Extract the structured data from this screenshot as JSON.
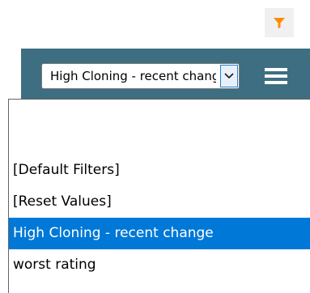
{
  "toolbar": {
    "filter_icon": "funnel-icon",
    "filter_icon_color": "#ff8c00",
    "background_color": "#3e6e81",
    "menu_icon": "hamburger-menu-icon"
  },
  "filter_select": {
    "value": "High Cloning - recent change",
    "arrow_icon": "chevron-down-icon"
  },
  "dropdown": {
    "options": [
      {
        "label": ""
      },
      {
        "label": "[Default Filters]"
      },
      {
        "label": "[Reset Values]"
      },
      {
        "label": "High Cloning - recent change"
      },
      {
        "label": "worst rating"
      }
    ],
    "selected_index": 3,
    "highlight_color": "#0078d7"
  }
}
